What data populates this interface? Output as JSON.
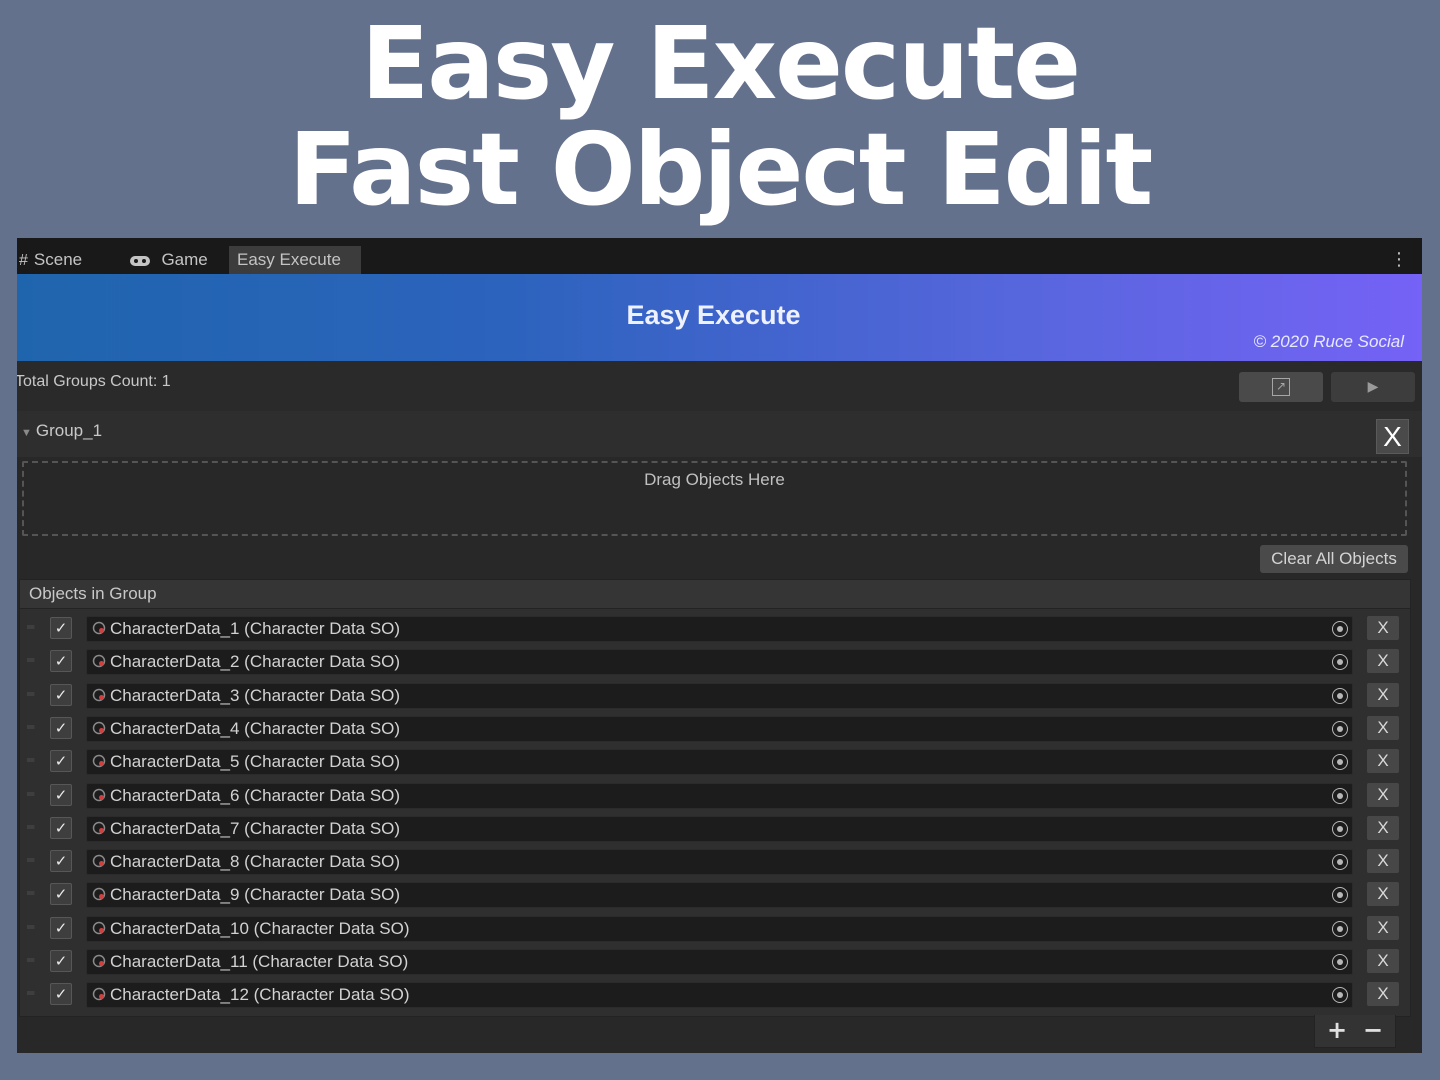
{
  "promo": {
    "line1": "Easy Execute",
    "line2": "Fast Object Edit"
  },
  "tabs": [
    {
      "label": "Scene",
      "icon": "grid-icon"
    },
    {
      "label": "Game",
      "icon": "gamepad-icon"
    },
    {
      "label": "Easy Execute",
      "icon": ""
    }
  ],
  "banner": {
    "title": "Easy Execute",
    "copyright": "© 2020 Ruce Social"
  },
  "toolbar": {
    "groups_count": "Total Groups Count: 1"
  },
  "group": {
    "name": "Group_1",
    "close_label": "X",
    "drop_text": "Drag Objects Here",
    "clear_label": "Clear All Objects",
    "list_header": "Objects in Group",
    "items": [
      {
        "name": "CharacterData_1 (Character Data SO)",
        "checked": true,
        "remove": "X"
      },
      {
        "name": "CharacterData_2 (Character Data SO)",
        "checked": true,
        "remove": "X"
      },
      {
        "name": "CharacterData_3 (Character Data SO)",
        "checked": true,
        "remove": "X"
      },
      {
        "name": "CharacterData_4 (Character Data SO)",
        "checked": true,
        "remove": "X"
      },
      {
        "name": "CharacterData_5 (Character Data SO)",
        "checked": true,
        "remove": "X"
      },
      {
        "name": "CharacterData_6 (Character Data SO)",
        "checked": true,
        "remove": "X"
      },
      {
        "name": "CharacterData_7 (Character Data SO)",
        "checked": true,
        "remove": "X"
      },
      {
        "name": "CharacterData_8 (Character Data SO)",
        "checked": true,
        "remove": "X"
      },
      {
        "name": "CharacterData_9 (Character Data SO)",
        "checked": true,
        "remove": "X"
      },
      {
        "name": "CharacterData_10 (Character Data SO)",
        "checked": true,
        "remove": "X"
      },
      {
        "name": "CharacterData_11 (Character Data SO)",
        "checked": true,
        "remove": "X"
      },
      {
        "name": "CharacterData_12 (Character Data SO)",
        "checked": true,
        "remove": "X"
      }
    ]
  },
  "colors": {
    "page_bg": "#64718c",
    "banner_start": "#1f65ad",
    "banner_end": "#7562f6",
    "panel_bg": "#282828"
  }
}
